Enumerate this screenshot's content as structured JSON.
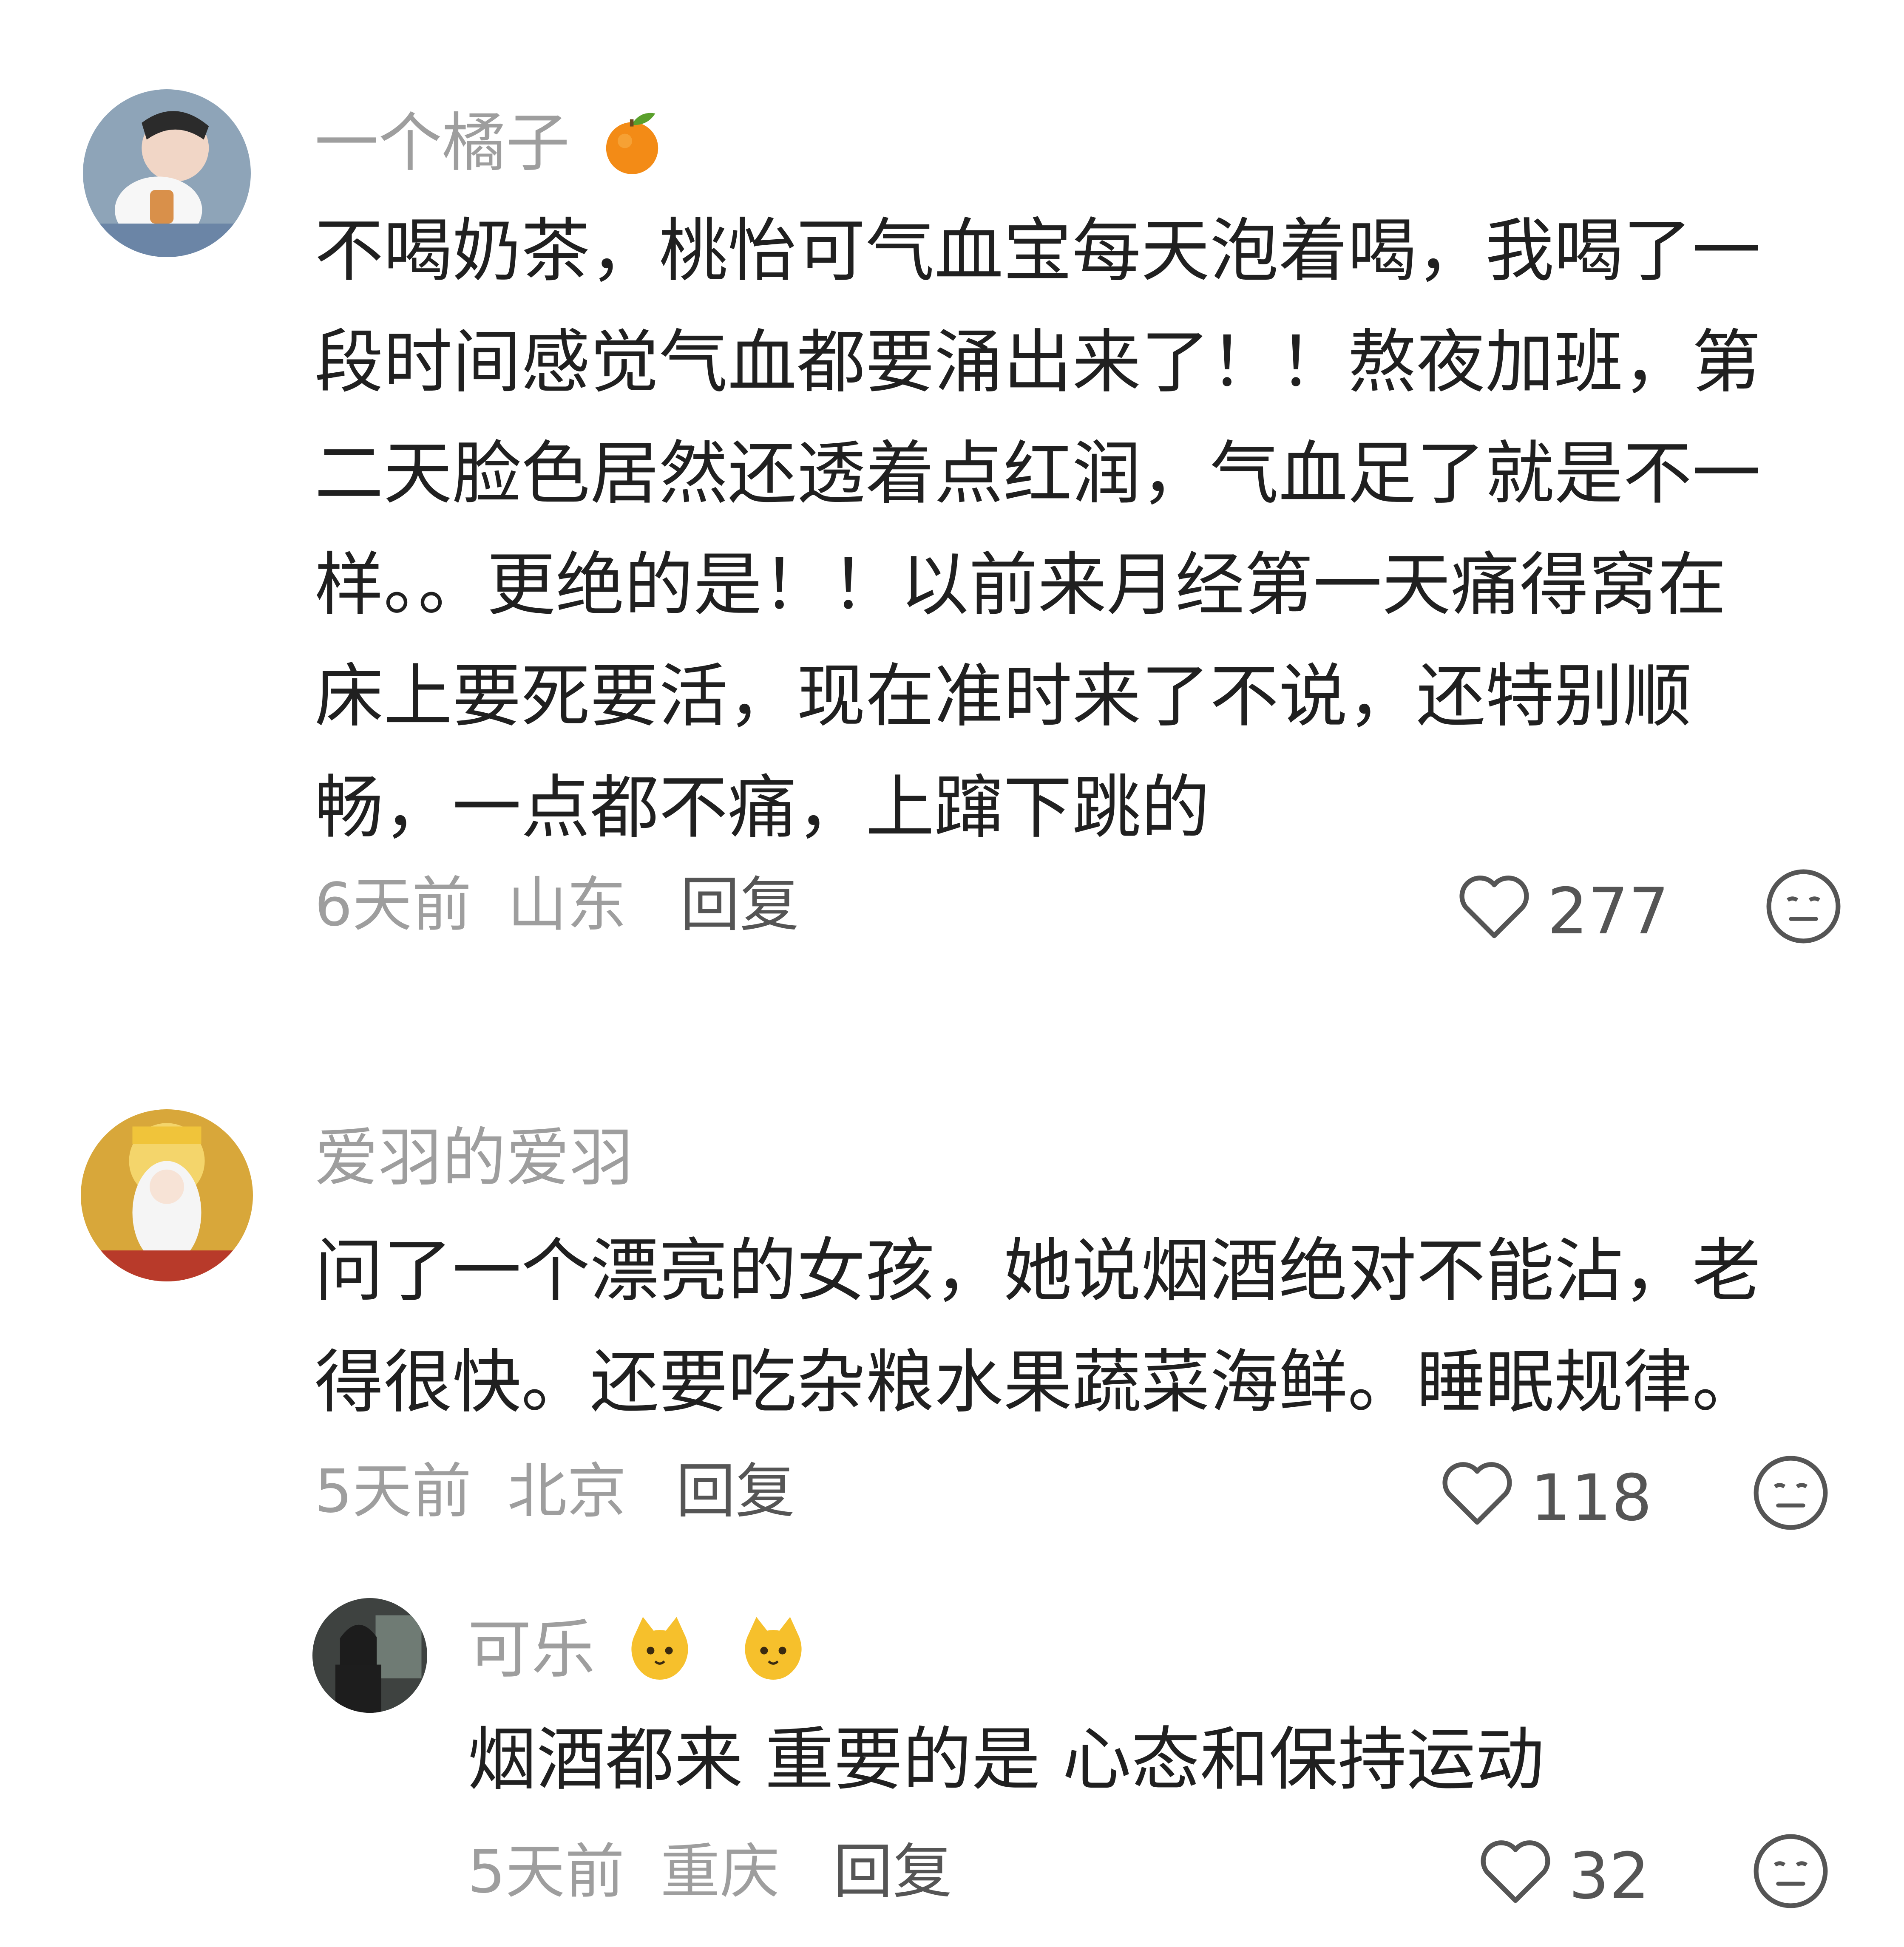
{
  "comments": [
    {
      "user": "一个橘子",
      "user_emoji": "tangerine-icon",
      "text": "不喝奶茶，桃怡可气血宝每天泡着喝，我喝了一段时间感觉气血都要涌出来了！！熬夜加班，第二天脸色居然还透着点红润，气血足了就是不一样。。更绝的是！！以前来月经第一天痛得窝在床上要死要活，现在准时来了不说，还特别顺畅，一点都不痛，上蹿下跳的",
      "time": "6天前",
      "location": "山东",
      "reply_label": "回复",
      "likes": "277"
    },
    {
      "user": "爱羽的爱羽",
      "text": "问了一个漂亮的女孩，她说烟酒绝对不能沾，老得很快。还要吃杂粮水果蔬菜海鲜。睡眠规律。",
      "time": "5天前",
      "location": "北京",
      "reply_label": "回复",
      "likes": "118"
    },
    {
      "user": "可乐",
      "user_emoji": "cat-face-icon",
      "text": "烟酒都来 重要的是 心态和保持运动",
      "time": "5天前",
      "location": "重庆",
      "reply_label": "回复",
      "likes": "32"
    }
  ],
  "colors": {
    "username": "#9e9e9e",
    "body_text": "#202020",
    "meta": "#9e9e9e",
    "icon": "#555555"
  }
}
